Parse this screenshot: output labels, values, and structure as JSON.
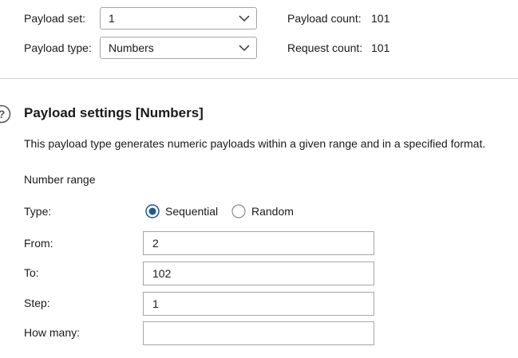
{
  "payload": {
    "set_label": "Payload set:",
    "set_value": "1",
    "type_label": "Payload type:",
    "type_value": "Numbers",
    "count_label": "Payload count:",
    "count_value": "101",
    "request_label": "Request count:",
    "request_value": "101"
  },
  "settings": {
    "title": "Payload settings [Numbers]",
    "description": "This payload type generates numeric payloads within a given range and in a specified format.",
    "number_range_label": "Number range",
    "type_label": "Type:",
    "type_options": [
      {
        "label": "Sequential",
        "selected": true
      },
      {
        "label": "Random",
        "selected": false
      }
    ],
    "from_label": "From:",
    "from_value": "2",
    "to_label": "To:",
    "to_value": "102",
    "step_label": "Step:",
    "step_value": "1",
    "how_many_label": "How many:",
    "how_many_value": ""
  },
  "colors": {
    "accent": "#1e5a8c",
    "border": "#a6a6a6"
  },
  "icons": [
    "chevron-down-icon",
    "help-icon"
  ]
}
